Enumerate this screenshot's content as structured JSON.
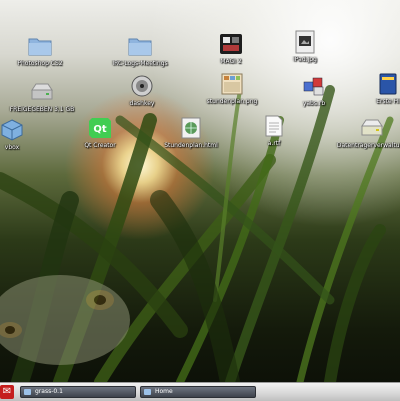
{
  "desktop": {
    "icons": [
      {
        "label": "Photoshop CS2",
        "icon": "folder-icon"
      },
      {
        "label": "IRC-Logs-Meetings",
        "icon": "folder-icon"
      },
      {
        "label": "MAGI 2",
        "icon": "app-icon"
      },
      {
        "label": "iPad.jpg",
        "icon": "image-file-icon"
      },
      {
        "label": "FREIGEGEBEN 3,1 GB",
        "icon": "drive-icon"
      },
      {
        "label": "dashkey",
        "icon": "disc-icon"
      },
      {
        "label": "stundenplan.png",
        "icon": "image-file-icon"
      },
      {
        "label": "yabs.rb",
        "icon": "ruby-file-icon"
      },
      {
        "label": "Erste Hi",
        "icon": "book-icon"
      },
      {
        "label": "vbox",
        "icon": "cube-icon"
      },
      {
        "label": "Qt Creator",
        "icon": "qt-icon"
      },
      {
        "label": "Stundenplan.html",
        "icon": "web-file-icon"
      },
      {
        "label": "a.rtf",
        "icon": "document-icon"
      },
      {
        "label": "Datenträgerverwaltung",
        "icon": "drive-icon"
      }
    ]
  },
  "taskbar": {
    "start_glyph": "✉",
    "tasks": [
      {
        "label": "grass-0.1"
      },
      {
        "label": "Home"
      }
    ]
  },
  "colors": {
    "folder": "#8fb4de",
    "taskbar_button": "#4a4f58",
    "start_button": "#c51d1d"
  }
}
